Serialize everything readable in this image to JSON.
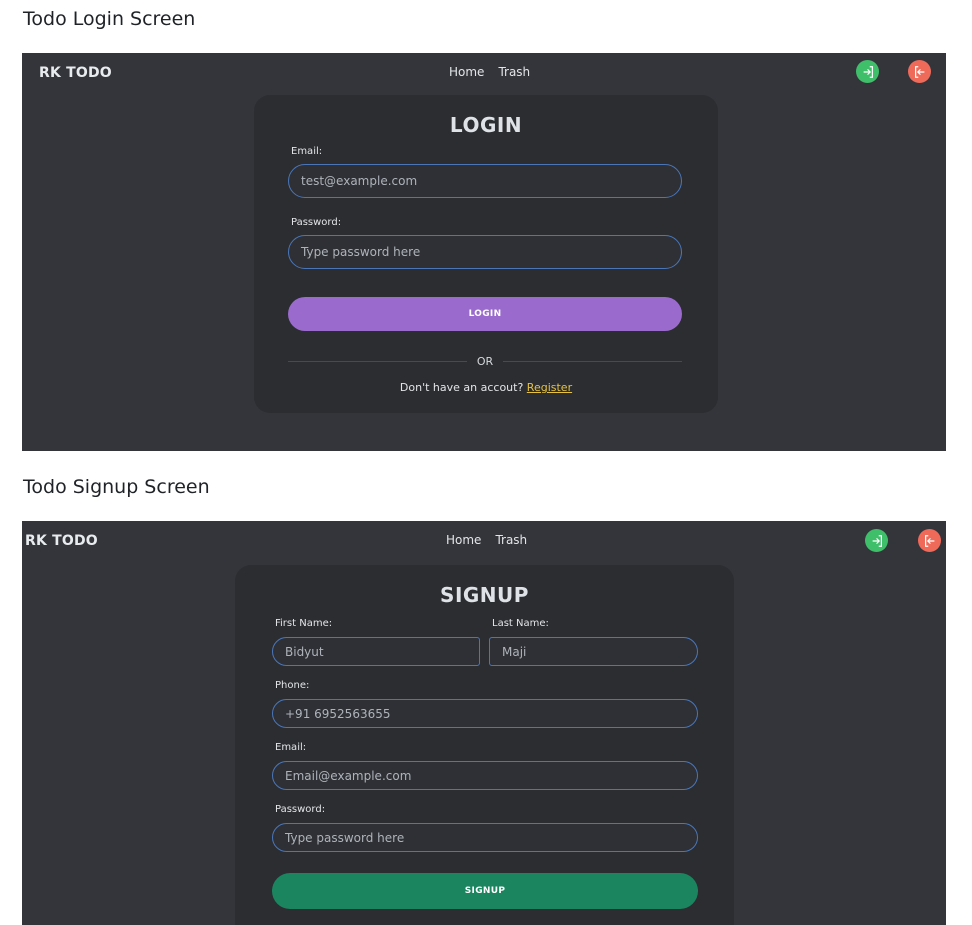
{
  "sections": {
    "login_title": "Todo Login Screen",
    "signup_title": "Todo Signup Screen"
  },
  "header": {
    "brand": "RK TODO",
    "nav": [
      "Home",
      "Trash"
    ],
    "icons": {
      "login": "login-arrow-icon",
      "logout": "logout-arrow-icon"
    },
    "colors": {
      "login_button": "#3fbf6a",
      "logout_button": "#f06a5a",
      "background": "#33353b"
    }
  },
  "login": {
    "title": "LOGIN",
    "email_label": "Email:",
    "email_placeholder": "test@example.com",
    "password_label": "Password:",
    "password_placeholder": "Type password here",
    "submit_label": "LOGIN",
    "submit_color": "#9a6bcd",
    "or_text": "OR",
    "register_prompt": "Don't have an accout?",
    "register_link": "Register",
    "link_color": "#e7c23f"
  },
  "signup": {
    "title": "SIGNUP",
    "first_name_label": "First Name:",
    "first_name_placeholder": "Bidyut",
    "last_name_label": "Last Name:",
    "last_name_placeholder": "Maji",
    "phone_label": "Phone:",
    "phone_placeholder": "+91 6952563655",
    "email_label": "Email:",
    "email_placeholder": "Email@example.com",
    "password_label": "Password:",
    "password_placeholder": "Type password here",
    "submit_label": "SIGNUP",
    "submit_color": "#1b8560"
  }
}
